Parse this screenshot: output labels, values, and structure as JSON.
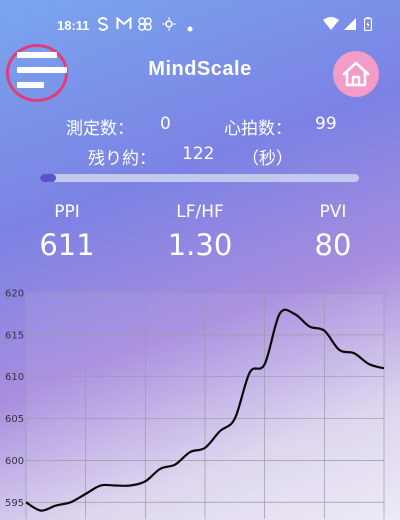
{
  "status_bar": {
    "time": "18:11",
    "icons": [
      "s-app-icon",
      "gmail-icon",
      "pinwheel-icon",
      "brightness-icon",
      "dot-icon",
      "wifi-icon",
      "signal-icon",
      "battery-icon"
    ]
  },
  "app": {
    "title": "MindScale"
  },
  "header": {
    "menu_icon": "menu-icon",
    "home_icon": "home-icon",
    "home_color": "#f39cc8",
    "menu_ring_color": "#e23d7a"
  },
  "stats": {
    "count_label": "測定数：",
    "count_value": "0",
    "hr_label": "心拍数：",
    "hr_value": "99",
    "remaining_label": "残り約：",
    "remaining_value": "122",
    "remaining_unit": "（秒）"
  },
  "progress": {
    "fraction": 0.05,
    "fill_color": "#5b54c9",
    "track_color": "#c2c8ee"
  },
  "metrics": [
    {
      "label": "PPI",
      "value": "611"
    },
    {
      "label": "LF/HF",
      "value": "1.30"
    },
    {
      "label": "PVI",
      "value": "80"
    }
  ],
  "chart_data": {
    "type": "line",
    "title": "",
    "xlabel": "",
    "ylabel": "",
    "ylim": [
      593,
      620
    ],
    "yticks": [
      595,
      600,
      605,
      610,
      615,
      620
    ],
    "grid": true,
    "x": [
      0,
      0.5,
      1,
      1.5,
      2,
      2.5,
      3,
      3.5,
      4,
      4.5,
      5,
      5.5,
      6,
      6.5,
      7,
      7.5,
      8,
      8.5,
      9,
      9.5,
      10,
      10.5,
      11,
      11.5,
      12
    ],
    "series": [
      {
        "values": [
          595,
          594,
          594.6,
          595,
          596,
          597,
          597,
          597,
          597.5,
          599,
          599.5,
          601,
          601.5,
          603.5,
          605,
          610.5,
          611.5,
          617.5,
          617.5,
          616,
          615.5,
          613.2,
          612.8,
          611.5,
          611
        ]
      }
    ],
    "line_color": "#0a0a0a"
  }
}
